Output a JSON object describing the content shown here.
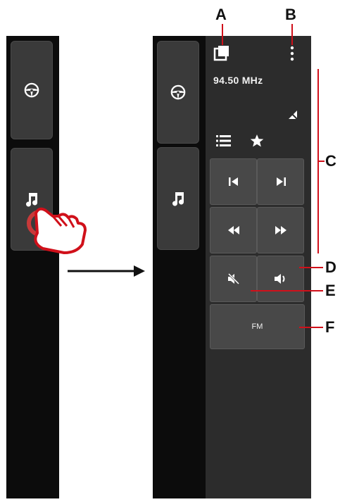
{
  "radio": {
    "frequency": "94.50 MHz",
    "fm_label": "FM"
  },
  "callouts": {
    "a": "A",
    "b": "B",
    "c": "C",
    "d": "D",
    "e": "E",
    "f": "F"
  },
  "icons": {
    "left_top": "steering-wheel-icon",
    "left_bottom": "music-note-icon",
    "hand": "pointing-hand-icon",
    "arrow": "right-arrow-icon",
    "copy": "window-copy-icon",
    "menu": "more-vertical-icon",
    "no_signal": "no-signal-icon",
    "list": "list-icon",
    "favorite": "star-icon",
    "prev": "skip-previous-icon",
    "next": "skip-next-icon",
    "rewind": "rewind-icon",
    "forward": "fast-forward-icon",
    "mute": "volume-mute-icon",
    "volume": "volume-icon"
  },
  "colors": {
    "callout_line": "#d0101a",
    "panel": "#2c2c2c",
    "button": "#484848"
  }
}
